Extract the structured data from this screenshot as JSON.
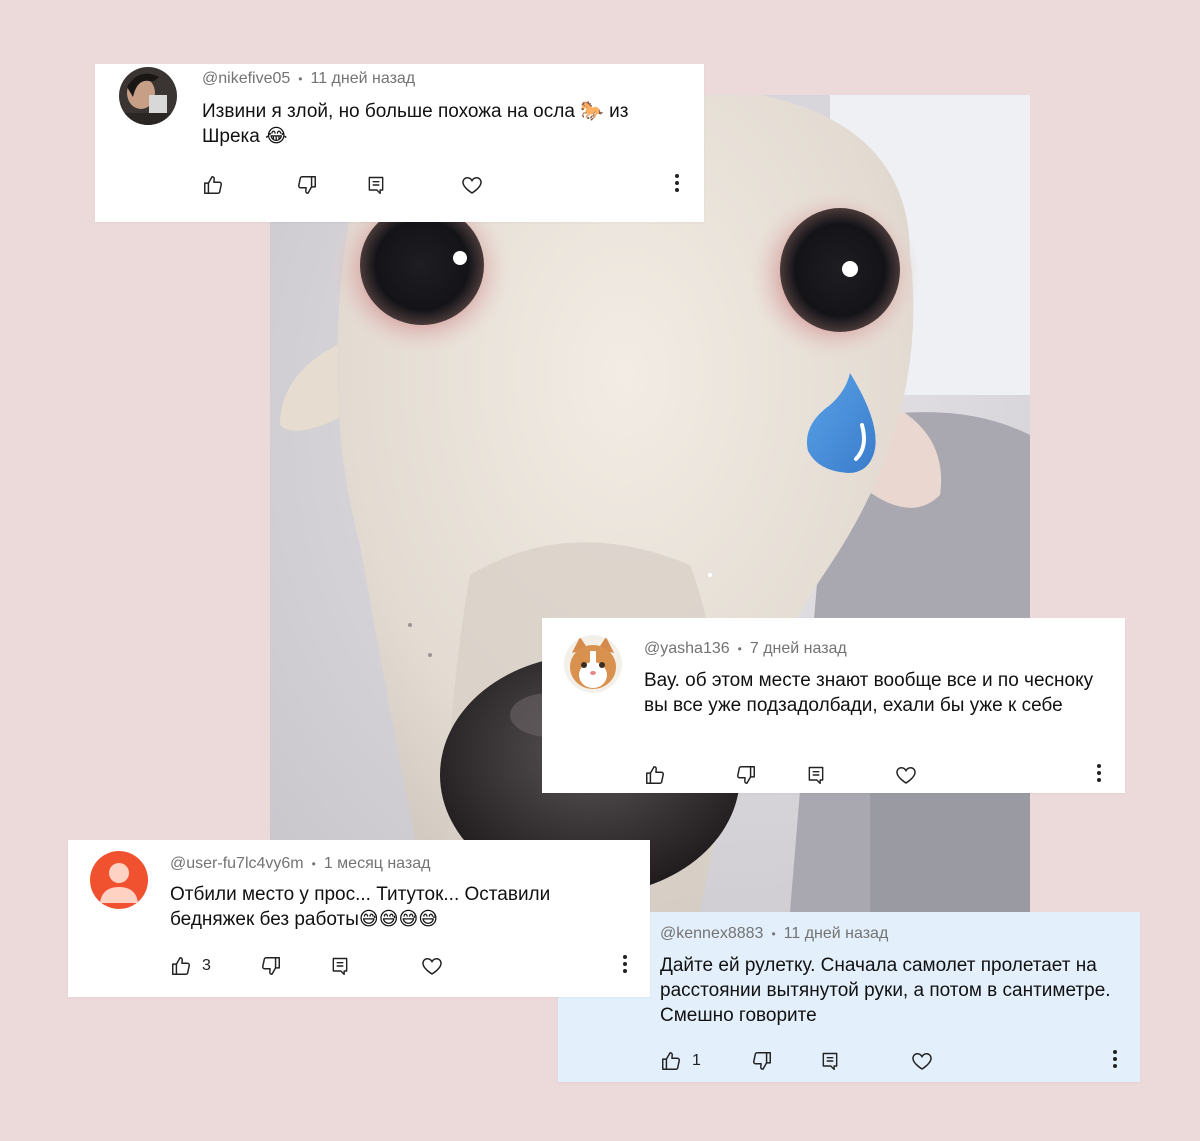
{
  "comments": [
    {
      "username": "@nikefive05",
      "time": "11 дней назад",
      "text": "Извини я злой, но больше похожа на осла 🐎 из Шрека 😂",
      "likes": ""
    },
    {
      "username": "@yasha136",
      "time": "7 дней назад",
      "text": "Вау. об этом месте знают вообще все и по чесноку вы все уже подзадолбади, ехали бы уже к себе",
      "likes": ""
    },
    {
      "username": "@user-fu7lc4vy6m",
      "time": "1 месяц назад",
      "text": "Отбили место у прос... Титуток... Оставили бедняжек без работы😅😅😅😅",
      "likes": "3"
    },
    {
      "username": "@kennex8883",
      "time": "11 дней назад",
      "text": "Дайте ей рулетку. Сначала самолет пролетает на расстоянии вытянутой руки, а потом в сантиметре. Смешно говорите",
      "likes": "1"
    }
  ],
  "colors": {
    "background": "#ecd9da",
    "card": "#ffffff",
    "highlight_card": "#e3f0fb",
    "meta_text": "#737373",
    "teardrop": "#4a8fd8",
    "default_avatar": "#f0522f"
  },
  "icons": [
    "thumbs-up-icon",
    "thumbs-down-icon",
    "reply-icon",
    "heart-icon",
    "more-vertical-icon"
  ]
}
